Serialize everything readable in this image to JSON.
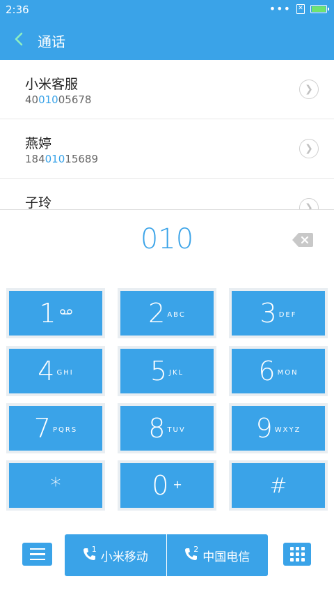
{
  "status": {
    "time": "2:36",
    "dots": "•••",
    "sim": "✕"
  },
  "header": {
    "title": "通话"
  },
  "contacts": [
    {
      "name": "小米客服",
      "num_pre": "40",
      "num_hl": "010",
      "num_post": "05678"
    },
    {
      "name": "燕婷",
      "num_pre": "184",
      "num_hl": "010",
      "num_post": "15689"
    },
    {
      "name": "子玲",
      "num_pre": "",
      "num_hl": "",
      "num_post": ""
    }
  ],
  "dial": {
    "entered": "010"
  },
  "keys": [
    {
      "digit": "1",
      "letters": ""
    },
    {
      "digit": "2",
      "letters": "ABC"
    },
    {
      "digit": "3",
      "letters": "DEF"
    },
    {
      "digit": "4",
      "letters": "GHI"
    },
    {
      "digit": "5",
      "letters": "JKL"
    },
    {
      "digit": "6",
      "letters": "MON"
    },
    {
      "digit": "7",
      "letters": "PQRS"
    },
    {
      "digit": "8",
      "letters": "TUV"
    },
    {
      "digit": "9",
      "letters": "WXYZ"
    },
    {
      "digit": "*",
      "letters": ""
    },
    {
      "digit": "0",
      "letters": "+"
    },
    {
      "digit": "#",
      "letters": ""
    }
  ],
  "calls": [
    {
      "sim": "1",
      "label": "小米移动"
    },
    {
      "sim": "2",
      "label": "中国电信"
    }
  ],
  "colors": {
    "accent": "#3aa3e8",
    "key_border": "#e9eef2",
    "battery": "#6fe36f"
  }
}
